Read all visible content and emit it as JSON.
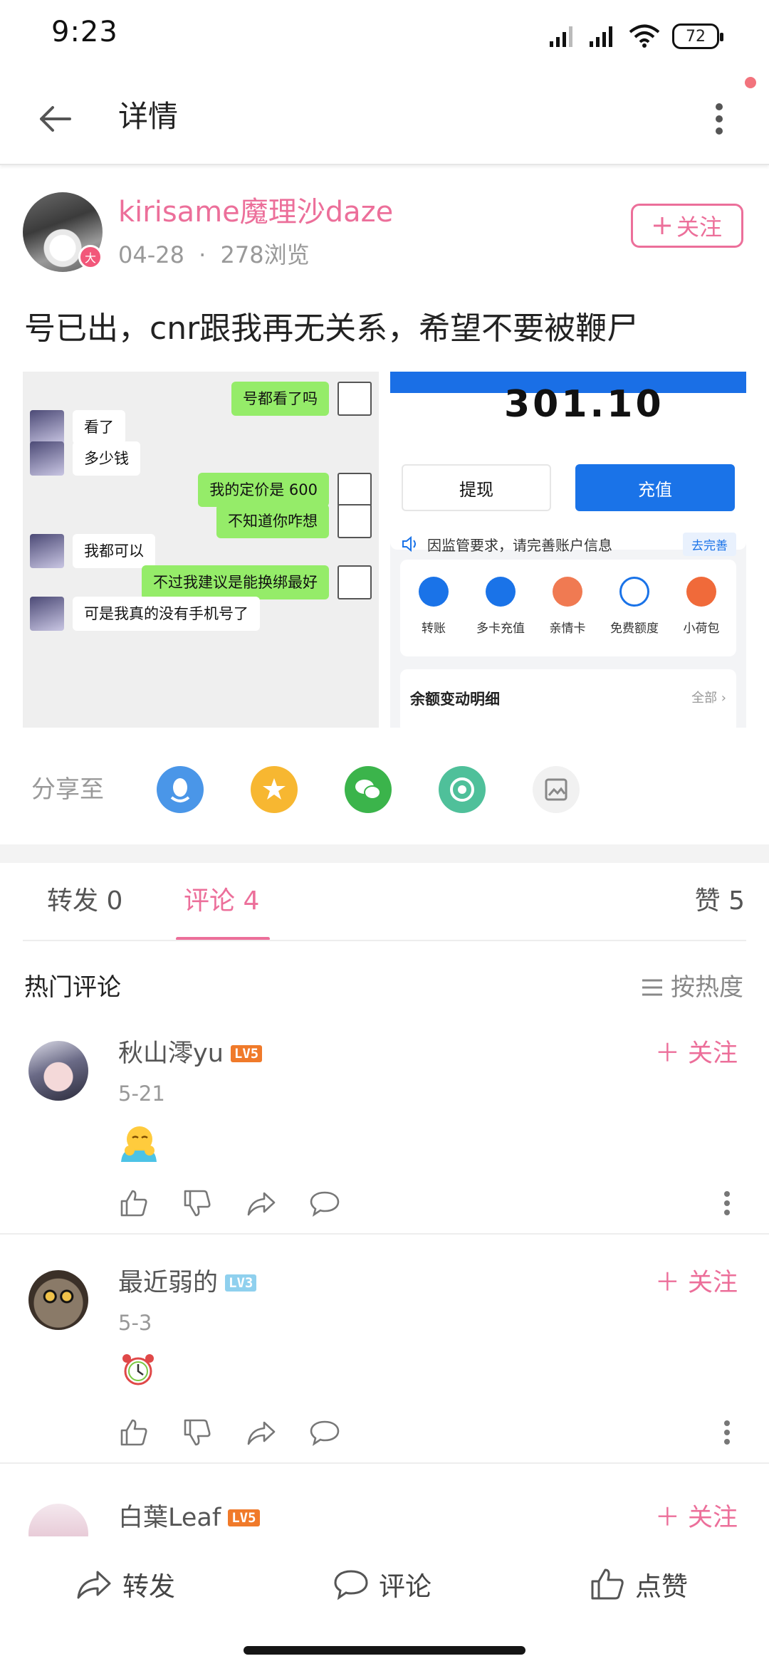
{
  "status_bar": {
    "time": "9:23",
    "battery": "72"
  },
  "header": {
    "title": "详情"
  },
  "author": {
    "name": "kirisame魔理沙daze",
    "date": "04-28",
    "separator": "·",
    "views": "278浏览",
    "follow_label": "关注",
    "badge": "大"
  },
  "post": {
    "text": "号已出，cnr跟我再无关系，希望不要被鞭尸"
  },
  "image_chat": {
    "messages": [
      {
        "side": "me",
        "text": "号都看了吗"
      },
      {
        "side": "them",
        "text": "看了"
      },
      {
        "side": "them",
        "text": "多少钱"
      },
      {
        "side": "me",
        "text": "我的定价是 600"
      },
      {
        "side": "me",
        "text": "不知道你咋想"
      },
      {
        "side": "them",
        "text": "我都可以"
      },
      {
        "side": "me",
        "text": "不过我建议是能换绑最好"
      },
      {
        "side": "them",
        "text": "可是我真的没有手机号了"
      }
    ]
  },
  "image_wallet": {
    "amount": "301.10",
    "withdraw_label": "提现",
    "recharge_label": "充值",
    "notice": "因监管要求，请完善账户信息",
    "notice_link": "去完善",
    "features": [
      "转账",
      "多卡充值",
      "亲情卡",
      "免费额度",
      "小荷包"
    ],
    "detail_title": "余额变动明细",
    "detail_all": "全部 ›"
  },
  "share": {
    "label": "分享至",
    "icons": [
      "qq-icon",
      "qzone-icon",
      "wechat-icon",
      "moments-icon",
      "save-image-icon"
    ]
  },
  "tabs": {
    "repost": "转发 0",
    "comments": "评论 4",
    "likes": "赞 5"
  },
  "hot": {
    "title": "热门评论",
    "sort_label": "按热度"
  },
  "comments": [
    {
      "name": "秋山澪yu",
      "level": "LV5",
      "level_color": "#f07a2a",
      "date": "5-21",
      "follow_label": "关注"
    },
    {
      "name": "最近弱的",
      "level": "LV3",
      "level_color": "#8fd0ee",
      "date": "5-3",
      "follow_label": "关注"
    },
    {
      "name": "白葉Leaf",
      "level": "LV5",
      "level_color": "#f07a2a",
      "date": "",
      "follow_label": "关注"
    }
  ],
  "bottom_bar": {
    "repost": "转发",
    "comment": "评论",
    "like": "点赞"
  },
  "colors": {
    "accent": "#ec6f9a",
    "wallet_blue": "#1a73e8",
    "chat_green": "#95ec69"
  }
}
